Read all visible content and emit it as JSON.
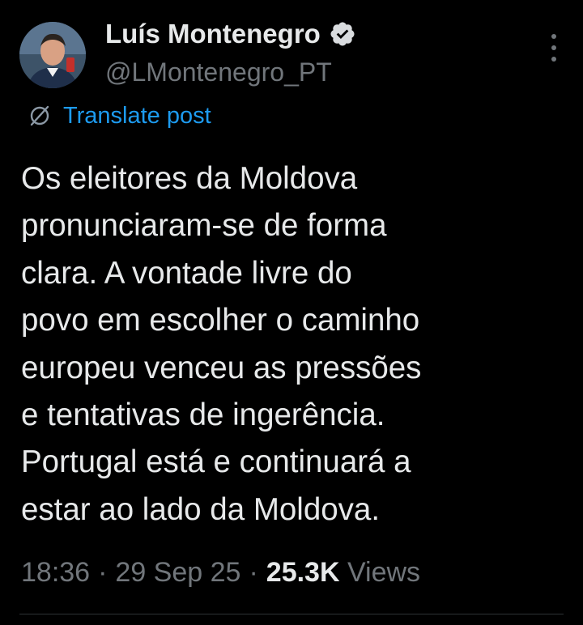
{
  "author": {
    "name": "Luís Montenegro",
    "handle": "@LMontenegro_PT",
    "verified": true,
    "avatar_icon": "profile-photo"
  },
  "translate": {
    "icon": "globe-translate-icon",
    "label": "Translate post"
  },
  "post": {
    "lines": [
      "Os eleitores da Moldova",
      "pronunciaram-se de forma",
      "clara. A vontade livre do",
      "povo em escolher o caminho",
      "europeu venceu as pressões",
      "e tentativas de ingerência.",
      "Portugal está e continuará a",
      "estar ao lado da Moldova."
    ]
  },
  "meta": {
    "time": "18:36",
    "date": "29 Sep 25",
    "views_count": "25.3K",
    "views_label": "Views",
    "separator": "·"
  },
  "colors": {
    "background": "#000000",
    "text": "#e7e9ea",
    "muted": "#71767b",
    "accent": "#1d9bf0"
  }
}
